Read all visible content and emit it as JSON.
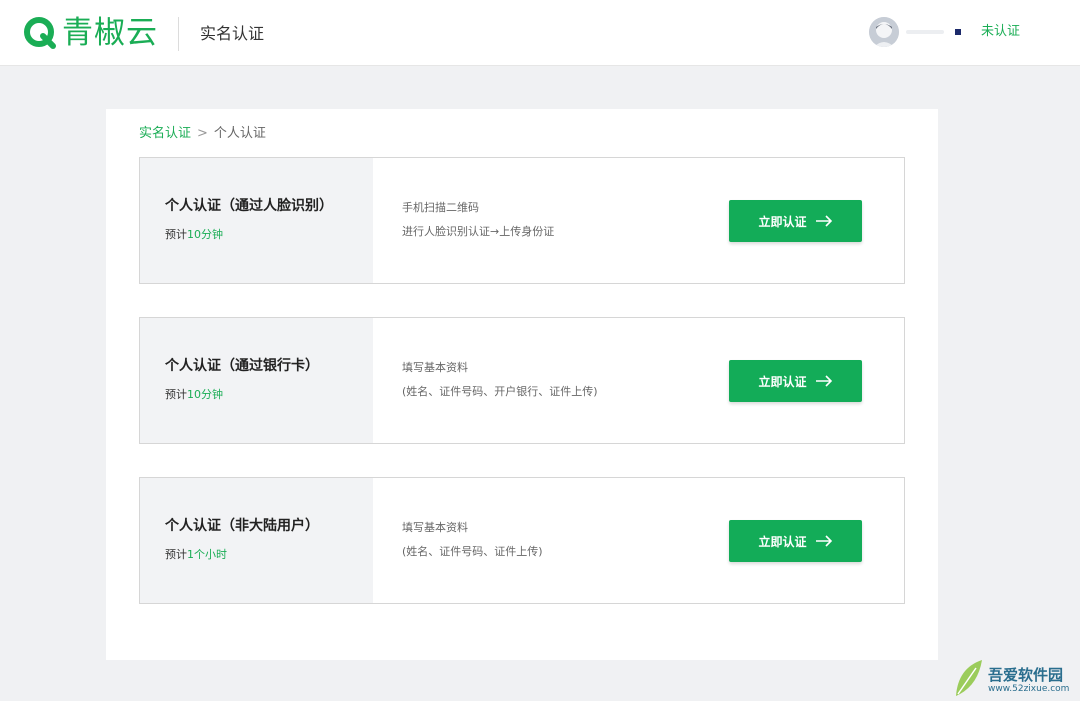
{
  "header": {
    "logo_text": "青椒云",
    "title": "实名认证",
    "status": "未认证"
  },
  "breadcrumb": {
    "parent": "实名认证",
    "separator": ">",
    "current": "个人认证"
  },
  "cards": [
    {
      "title": "个人认证（通过人脸识别）",
      "time_prefix": "预计",
      "time_value": "10分钟",
      "desc1": "手机扫描二维码",
      "desc2": "进行人脸识别认证→上传身份证",
      "button": "立即认证"
    },
    {
      "title": "个人认证（通过银行卡）",
      "time_prefix": "预计",
      "time_value": "10分钟",
      "desc1": "填写基本资料",
      "desc2": "(姓名、证件号码、开户银行、证件上传)",
      "button": "立即认证"
    },
    {
      "title": "个人认证（非大陆用户）",
      "time_prefix": "预计",
      "time_value": "1个小时",
      "desc1": "填写基本资料",
      "desc2": "(姓名、证件号码、证件上传)",
      "button": "立即认证"
    }
  ],
  "watermark": {
    "text": "吾爱软件园",
    "url": "www.52zixue.com"
  },
  "colors": {
    "brand": "#1aad55",
    "button": "#13ac58",
    "background": "#f0f1f3"
  },
  "icons": {
    "logo": "q-logo-icon",
    "avatar": "user-avatar-icon",
    "arrow": "arrow-right-icon"
  }
}
